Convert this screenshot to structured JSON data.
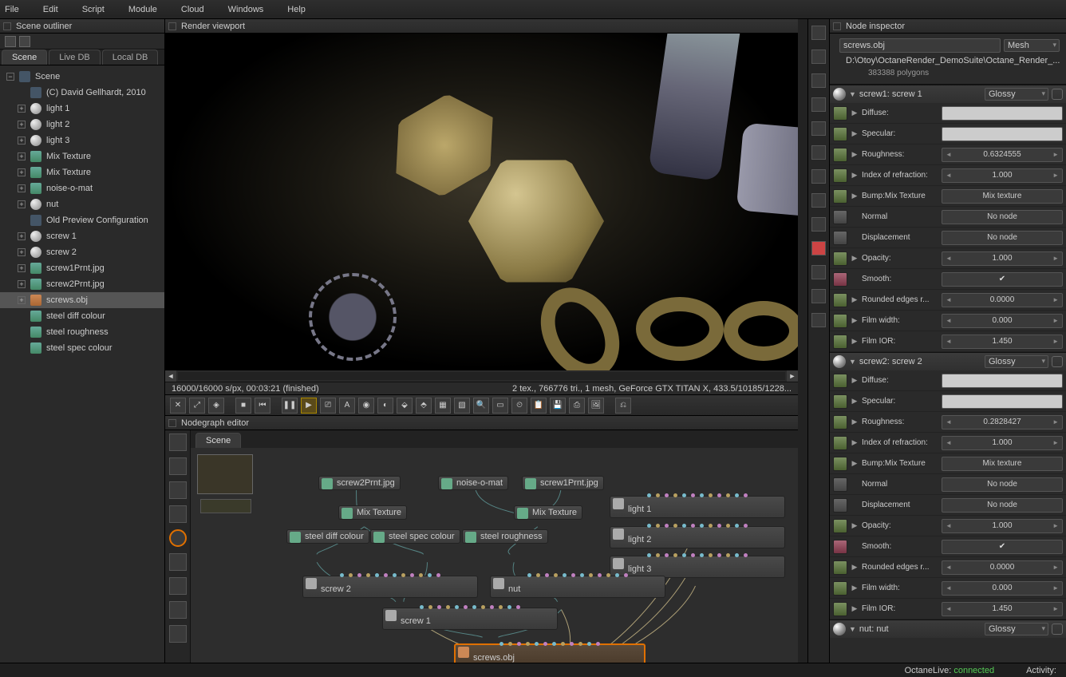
{
  "menu": {
    "file": "File",
    "edit": "Edit",
    "script": "Script",
    "module": "Module",
    "cloud": "Cloud",
    "windows": "Windows",
    "help": "Help"
  },
  "outliner": {
    "title": "Scene outliner",
    "tabs": {
      "scene": "Scene",
      "livedb": "Live DB",
      "localdb": "Local DB"
    },
    "root": "Scene",
    "items": [
      "(C) David Gellhardt, 2010",
      "light 1",
      "light 2",
      "light 3",
      "Mix Texture",
      "Mix Texture",
      "noise-o-mat",
      "nut",
      "Old Preview Configuration",
      "screw 1",
      "screw 2",
      "screw1Prnt.jpg",
      "screw2Prnt.jpg",
      "screws.obj",
      "steel diff colour",
      "steel roughness",
      "steel spec colour"
    ],
    "selected": "screws.obj"
  },
  "viewport": {
    "title": "Render viewport",
    "status_left": "16000/16000 s/px, 00:03:21 (finished)",
    "status_right": "2 tex., 766776 tri., 1 mesh, GeForce GTX TITAN X, 433.5/10185/1228..."
  },
  "nodegraph": {
    "title": "Nodegraph editor",
    "tab": "Scene",
    "nodes": {
      "screw2prnt": "screw2Prnt.jpg",
      "noiseomat": "noise-o-mat",
      "screw1prnt": "screw1Prnt.jpg",
      "mixtex1": "Mix Texture",
      "mixtex2": "Mix Texture",
      "steeldiff": "steel diff colour",
      "steelspec": "steel spec colour",
      "steelrough": "steel roughness",
      "light1": "light 1",
      "light2": "light 2",
      "light3": "light 3",
      "screw2": "screw 2",
      "nut": "nut",
      "screw1": "screw 1",
      "screwsobj": "screws.obj"
    }
  },
  "inspector": {
    "title": "Node inspector",
    "obj_name": "screws.obj",
    "obj_type": "Mesh",
    "path": "D:\\Otoy\\OctaneRender_DemoSuite\\Octane_Render_...",
    "polycount": "383388 polygons",
    "materials": [
      {
        "name": "screw1: screw 1",
        "shader": "Glossy",
        "props": {
          "diffuse": "Diffuse:",
          "specular": "Specular:",
          "roughness_l": "Roughness:",
          "roughness_v": "0.6324555",
          "ior_l": "Index of refraction:",
          "ior_v": "1.000",
          "bump_l": "Bump:Mix Texture",
          "bump_v": "Mix texture",
          "normal_l": "Normal",
          "normal_v": "No node",
          "disp_l": "Displacement",
          "disp_v": "No node",
          "opacity_l": "Opacity:",
          "opacity_v": "1.000",
          "smooth_l": "Smooth:",
          "round_l": "Rounded edges r...",
          "round_v": "0.0000",
          "filmw_l": "Film width:",
          "filmw_v": "0.000",
          "filmior_l": "Film IOR:",
          "filmior_v": "1.450"
        }
      },
      {
        "name": "screw2: screw 2",
        "shader": "Glossy",
        "props": {
          "diffuse": "Diffuse:",
          "specular": "Specular:",
          "roughness_l": "Roughness:",
          "roughness_v": "0.2828427",
          "ior_l": "Index of refraction:",
          "ior_v": "1.000",
          "bump_l": "Bump:Mix Texture",
          "bump_v": "Mix texture",
          "normal_l": "Normal",
          "normal_v": "No node",
          "disp_l": "Displacement",
          "disp_v": "No node",
          "opacity_l": "Opacity:",
          "opacity_v": "1.000",
          "smooth_l": "Smooth:",
          "round_l": "Rounded edges r...",
          "round_v": "0.0000",
          "filmw_l": "Film width:",
          "filmw_v": "0.000",
          "filmior_l": "Film IOR:",
          "filmior_v": "1.450"
        }
      },
      {
        "name": "nut: nut",
        "shader": "Glossy"
      }
    ]
  },
  "footer": {
    "octanelive_l": "OctaneLive:",
    "octanelive_v": "connected",
    "activity": "Activity:"
  }
}
